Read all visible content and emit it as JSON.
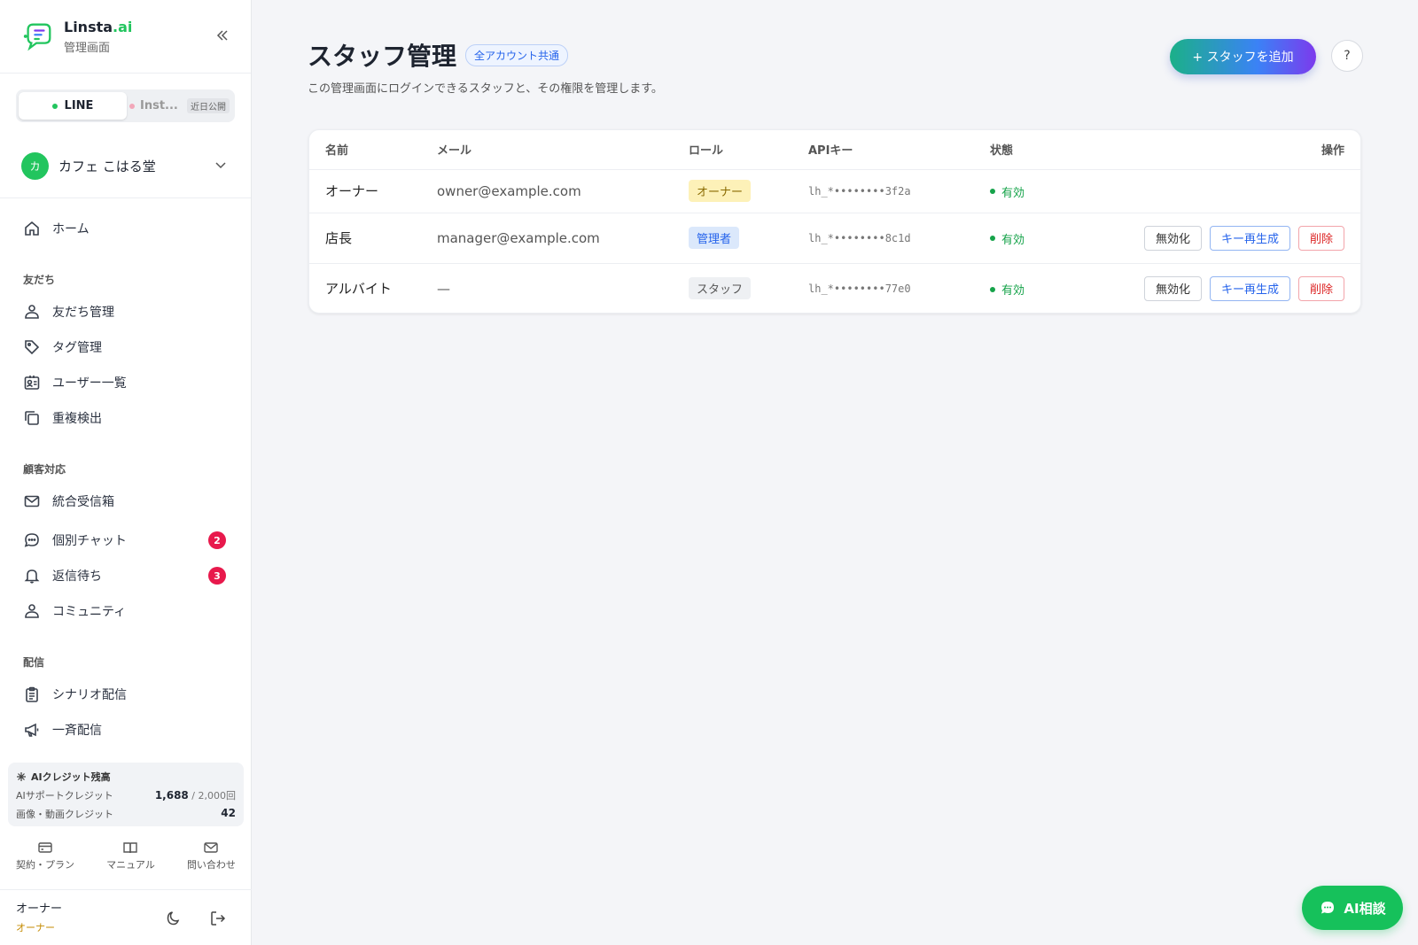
{
  "brand": {
    "name_main": "Linsta",
    "name_suffix": ".ai",
    "subtitle": "管理画面"
  },
  "channels": {
    "line_label": "LINE",
    "insta_label": "Inst...",
    "insta_badge": "近日公開"
  },
  "account": {
    "initial": "カ",
    "name": "カフェ こはる堂"
  },
  "nav": {
    "home": "ホーム",
    "sections": {
      "friends": "友だち",
      "support": "顧客対応",
      "delivery": "配信"
    },
    "friends_items": [
      "友だち管理",
      "タグ管理",
      "ユーザー一覧",
      "重複検出"
    ],
    "support_items": [
      "統合受信箱",
      "個別チャット",
      "返信待ち",
      "コミュニティ"
    ],
    "support_badges": {
      "chat": "2",
      "pending": "3"
    },
    "delivery_items": [
      "シナリオ配信",
      "一斉配信"
    ]
  },
  "credits": {
    "title": "AIクレジット残高",
    "support_label": "AIサポートクレジット",
    "support_value": "1,688",
    "support_max": " / 2,000回",
    "media_label": "画像・動画クレジット",
    "media_value": "42"
  },
  "footer_links": [
    "契約・プラン",
    "マニュアル",
    "問い合わせ"
  ],
  "user": {
    "name": "オーナー",
    "role": "オーナー"
  },
  "page": {
    "title": "スタッフ管理",
    "scope_badge": "全アカウント共通",
    "description": "この管理画面にログインできるスタッフと、その権限を管理します。",
    "add_button": "+ スタッフを追加",
    "help_button": "?"
  },
  "table": {
    "headers": [
      "名前",
      "メール",
      "ロール",
      "APIキー",
      "状態",
      "操作"
    ],
    "rows": [
      {
        "name": "オーナー",
        "email": "owner@example.com",
        "role": "オーナー",
        "api_key": "lh_*••••••••3f2a",
        "status": "有効"
      },
      {
        "name": "店長",
        "email": "manager@example.com",
        "role": "管理者",
        "api_key": "lh_*••••••••8c1d",
        "status": "有効"
      },
      {
        "name": "アルバイト",
        "email": "—",
        "role": "スタッフ",
        "api_key": "lh_*••••••••77e0",
        "status": "有効"
      }
    ],
    "actions": {
      "disable": "無効化",
      "regenerate": "キー再生成",
      "delete": "削除"
    }
  },
  "colors": {
    "accent_green": "#22c55e",
    "badge_red": "#e8194c",
    "role_owner_bg": "#fdf1b8",
    "role_owner_text": "#8a6a00",
    "role_admin_bg": "#dbe8fb",
    "role_admin_text": "#2563eb",
    "role_staff_bg": "#eef0f3",
    "role_staff_text": "#555555"
  },
  "ai_button": "AI相談"
}
